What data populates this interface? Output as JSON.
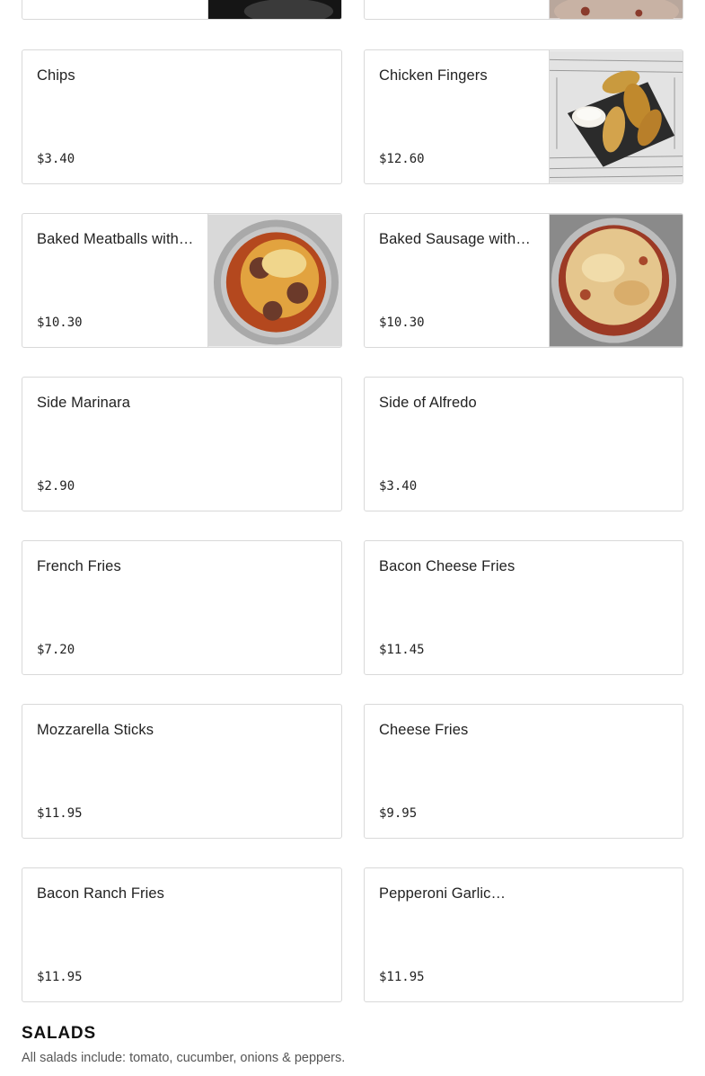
{
  "menu": {
    "items": [
      {
        "name": "Chips",
        "price": "$3.40",
        "image": false
      },
      {
        "name": "Chicken Fingers",
        "price": "$12.60",
        "image": true,
        "image_icon": "chicken-fingers-photo"
      },
      {
        "name": "Baked Meatballs with…",
        "price": "$10.30",
        "image": true,
        "image_icon": "baked-meatballs-photo"
      },
      {
        "name": "Baked Sausage with…",
        "price": "$10.30",
        "image": true,
        "image_icon": "baked-sausage-photo"
      },
      {
        "name": "Side Marinara",
        "price": "$2.90",
        "image": false
      },
      {
        "name": "Side of Alfredo",
        "price": "$3.40",
        "image": false
      },
      {
        "name": "French Fries",
        "price": "$7.20",
        "image": false
      },
      {
        "name": "Bacon Cheese Fries",
        "price": "$11.45",
        "image": false
      },
      {
        "name": "Mozzarella Sticks",
        "price": "$11.95",
        "image": false
      },
      {
        "name": "Cheese Fries",
        "price": "$9.95",
        "image": false
      },
      {
        "name": "Bacon Ranch Fries",
        "price": "$11.95",
        "image": false
      },
      {
        "name": "Pepperoni Garlic…",
        "price": "$11.95",
        "image": false
      }
    ]
  },
  "salads": {
    "title": "SALADS",
    "description": "All salads include: tomato, cucumber, onions & peppers."
  }
}
